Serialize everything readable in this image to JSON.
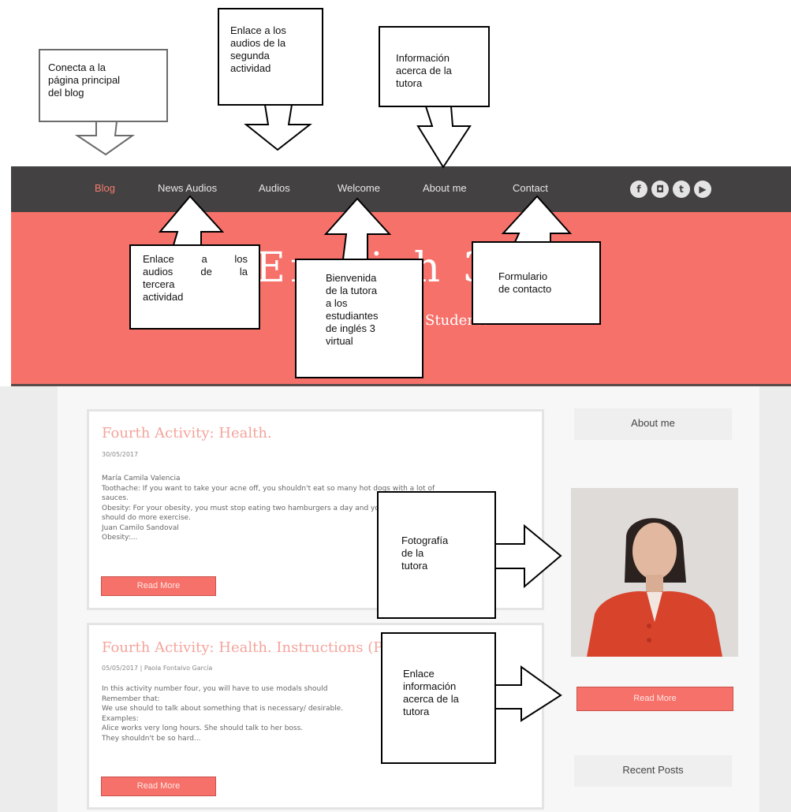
{
  "nav": {
    "items": [
      "Blog",
      "News Audios",
      "Audios",
      "Welcome",
      "About me",
      "Contact"
    ],
    "social": [
      {
        "icon": "facebook-icon",
        "glyph": "f"
      },
      {
        "icon": "instagram-icon",
        "glyph": "◘"
      },
      {
        "icon": "twitter-icon",
        "glyph": "t"
      },
      {
        "icon": "youtube-icon",
        "glyph": "▶"
      }
    ]
  },
  "hero": {
    "title": "English 3",
    "subtitle": "Students"
  },
  "posts": [
    {
      "title": "Fourth Activity: Health.",
      "meta": "30/05/2017",
      "lines": [
        "María Camila Valencia",
        "Toothache: If you want to take your acne off, you shouldn't eat so many hot dogs with a lot of",
        "sauces.",
        "Obesity: For your obesity, you must stop eating two hamburgers a day and you",
        "should do more exercise.",
        "Juan Camilo Sandoval",
        "Obesity:..."
      ],
      "button": "Read More"
    },
    {
      "title": "Fourth Activity: Health. Instructions (Practice)",
      "meta": "05/05/2017   |  Paola Fontalvo García",
      "lines": [
        "In this activity number four, you will have to use modals should",
        "Remember that:",
        "We use should to talk about something that is necessary/ desirable.",
        "Examples:",
        " Alice works very long hours. She should talk to her boss.",
        " They shouldn't be so hard..."
      ],
      "button": "Read More"
    }
  ],
  "sidebar": {
    "about_title": "About me",
    "read_more": "Read More",
    "recent_title": "Recent Posts"
  },
  "callouts": {
    "blog": [
      "Conecta a la",
      "página principal",
      "del blog"
    ],
    "audios2": [
      "Enlace a los",
      "audios de la",
      "segunda",
      "actividad"
    ],
    "about": [
      "Información",
      "acerca de la",
      "tutora"
    ],
    "audios3": [
      "Enlace a los",
      "audios de la",
      "tercera",
      "actividad"
    ],
    "welcome": [
      "Bienvenida",
      "de la tutora",
      "a los",
      "estudiantes",
      "de inglés 3",
      "virtual"
    ],
    "contact": [
      "Formulario",
      "de contacto"
    ],
    "photo": [
      "Fotografía",
      "de la",
      "tutora"
    ],
    "link": [
      "Enlace",
      "información",
      "acerca de la",
      "tutora"
    ]
  }
}
